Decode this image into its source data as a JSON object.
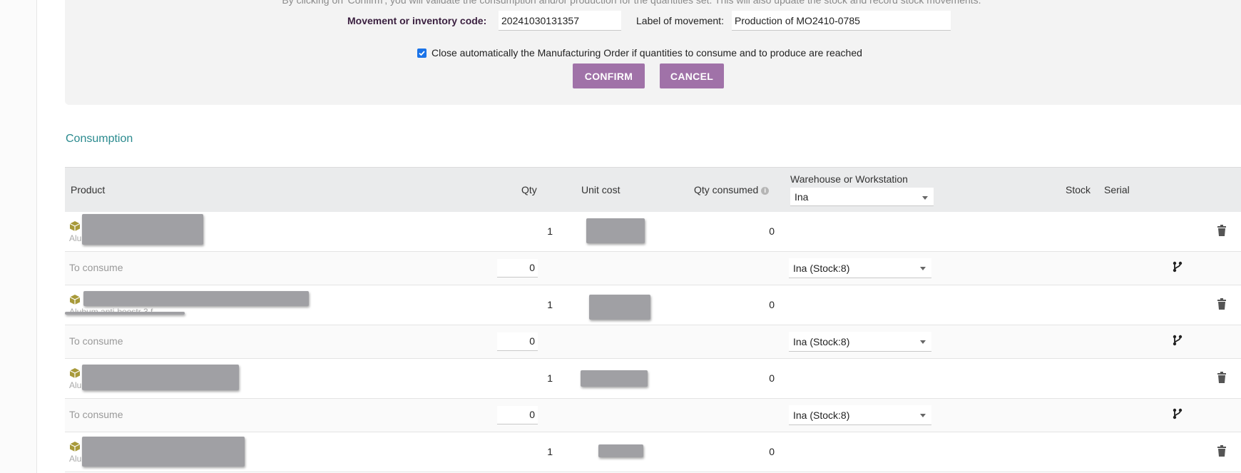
{
  "panel": {
    "intro_text": "By clicking on 'Confirm', you will validate the consumption and/or production for the quantities set. This will also update the stock and record stock movements.",
    "movement_code_label": "Movement or inventory code:",
    "movement_code_value": "20241030131357",
    "movement_label_label": "Label of movement:",
    "movement_label_value": "Production of MO2410-0785",
    "auto_close_checked": true,
    "auto_close_label": "Close automatically the Manufacturing Order if quantities to consume and to produce are reached",
    "confirm_label": "CONFIRM",
    "cancel_label": "CANCEL"
  },
  "consumption": {
    "title": "Consumption",
    "headers": {
      "product": "Product",
      "qty": "Qty",
      "unit_cost": "Unit cost",
      "qty_consumed": "Qty consumed",
      "warehouse": "Warehouse or Workstation",
      "stock": "Stock",
      "serial": "Serial"
    },
    "header_warehouse_select": "Ina",
    "rows": [
      {
        "ref": "Alu",
        "qty": "1",
        "qty_consumed": "0",
        "to_consume_label": "To consume",
        "to_consume_value": "0",
        "warehouse": "Ina (Stock:8)"
      },
      {
        "ref": "Alubum anti-boostr 3 f...",
        "qty": "1",
        "qty_consumed": "0",
        "to_consume_label": "To consume",
        "to_consume_value": "0",
        "warehouse": "Ina (Stock:8)"
      },
      {
        "ref": "Alu",
        "qty": "1",
        "qty_consumed": "0",
        "to_consume_label": "To consume",
        "to_consume_value": "0",
        "warehouse": "Ina (Stock:8)"
      },
      {
        "ref": "Alu",
        "qty": "1",
        "qty_consumed": "0"
      }
    ]
  },
  "colors": {
    "button": "#a072a8",
    "section_title": "#2a8a8e",
    "product_icon": "#a89a3a"
  },
  "icons": {
    "product": "cube-icon",
    "delete": "trash-icon",
    "split": "split-icon",
    "info": "info-icon"
  }
}
